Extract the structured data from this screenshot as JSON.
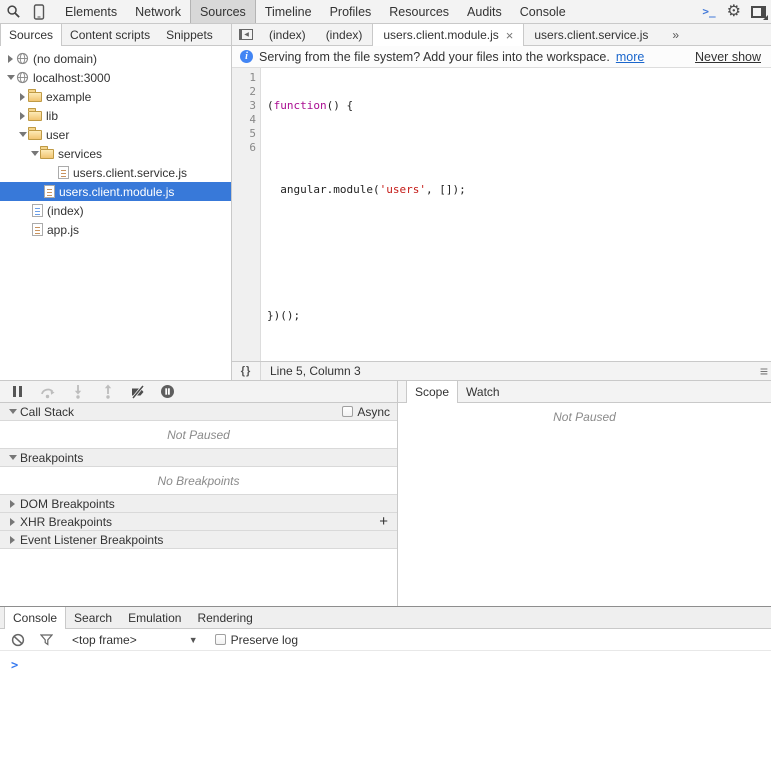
{
  "toolbar": {
    "tabs": [
      {
        "label": "Elements"
      },
      {
        "label": "Network"
      },
      {
        "label": "Sources",
        "selected": true
      },
      {
        "label": "Timeline"
      },
      {
        "label": "Profiles"
      },
      {
        "label": "Resources"
      },
      {
        "label": "Audits"
      },
      {
        "label": "Console"
      }
    ],
    "console_toggle_glyph": ">_"
  },
  "sidebar": {
    "tabs": [
      {
        "label": "Sources",
        "selected": true
      },
      {
        "label": "Content scripts"
      },
      {
        "label": "Snippets"
      }
    ],
    "tree": [
      {
        "label": "(no domain)",
        "icon": "globe-icon",
        "state": "collapsed"
      },
      {
        "label": "localhost:3000",
        "icon": "globe-icon",
        "state": "expanded"
      },
      {
        "label": "example",
        "icon": "folder-icon",
        "state": "collapsed"
      },
      {
        "label": "lib",
        "icon": "folder-icon",
        "state": "collapsed"
      },
      {
        "label": "user",
        "icon": "folder-icon",
        "state": "expanded"
      },
      {
        "label": "services",
        "icon": "folder-icon",
        "state": "expanded"
      },
      {
        "label": "users.client.service.js",
        "icon": "js-file-icon"
      },
      {
        "label": "users.client.module.js",
        "icon": "js-file-icon",
        "selected": true
      },
      {
        "label": "(index)",
        "icon": "html-file-icon"
      },
      {
        "label": "app.js",
        "icon": "js-file-icon"
      }
    ]
  },
  "editor": {
    "tabs": [
      {
        "label": "(index)"
      },
      {
        "label": "(index)"
      },
      {
        "label": "users.client.module.js",
        "active": true,
        "close_glyph": "×"
      },
      {
        "label": "users.client.service.js"
      }
    ],
    "overflow_glyph": "»",
    "infobar": {
      "message": "Serving from the file system? Add your files into the workspace.",
      "more_link": "more",
      "never_show_link": "Never show"
    },
    "code": {
      "lines": [
        {
          "num": "1",
          "segments": [
            {
              "text": "(",
              "type": "plain"
            },
            {
              "text": "function",
              "type": "keyword"
            },
            {
              "text": "() {",
              "type": "plain"
            }
          ]
        },
        {
          "num": "2",
          "segments": []
        },
        {
          "num": "3",
          "segments": [
            {
              "text": "  angular.module(",
              "type": "plain"
            },
            {
              "text": "'users'",
              "type": "string"
            },
            {
              "text": ", []);",
              "type": "plain"
            }
          ]
        },
        {
          "num": "4",
          "segments": []
        },
        {
          "num": "5",
          "segments": []
        },
        {
          "num": "6",
          "segments": [
            {
              "text": "})();",
              "type": "plain"
            }
          ]
        }
      ]
    },
    "statusbar": {
      "pretty_print_glyph": "{}",
      "position": "Line 5, Column 3"
    }
  },
  "debugger": {
    "call_stack": {
      "label": "Call Stack",
      "async_label": "Async",
      "empty": "Not Paused"
    },
    "breakpoints": {
      "label": "Breakpoints",
      "empty": "No Breakpoints"
    },
    "dom_breakpoints": {
      "label": "DOM Breakpoints"
    },
    "xhr_breakpoints": {
      "label": "XHR Breakpoints",
      "add_glyph": "+"
    },
    "event_listener_breakpoints": {
      "label": "Event Listener Breakpoints"
    },
    "side_tabs": [
      {
        "label": "Scope",
        "selected": true
      },
      {
        "label": "Watch"
      }
    ],
    "scope_empty": "Not Paused"
  },
  "drawer": {
    "tabs": [
      {
        "label": "Console",
        "selected": true
      },
      {
        "label": "Search"
      },
      {
        "label": "Emulation"
      },
      {
        "label": "Rendering"
      }
    ],
    "frame_selector": "<top frame>",
    "dropdown_glyph": "▼",
    "preserve_log_label": "Preserve log",
    "prompt_glyph": ">"
  },
  "colors": {
    "selection_blue": "#3879d9",
    "keyword": "#aa0d91",
    "string": "#c41a16",
    "link_blue": "#1a66cc",
    "info_blue": "#4285f4"
  }
}
